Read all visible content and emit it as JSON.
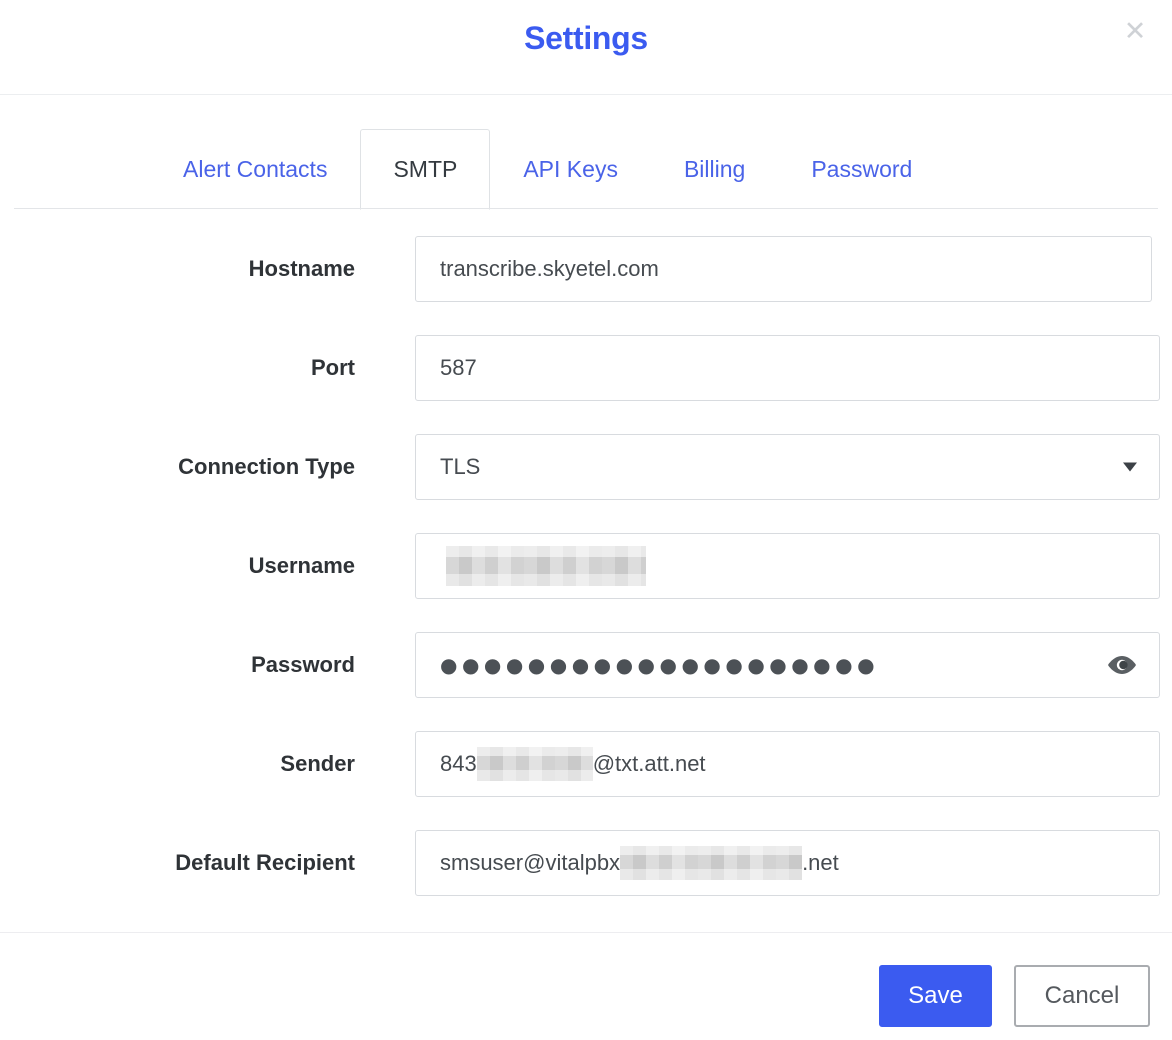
{
  "header": {
    "title": "Settings",
    "close_icon": "close-icon",
    "close_glyph": "✕"
  },
  "tabs": [
    {
      "label": "Alert Contacts",
      "active": false
    },
    {
      "label": "SMTP",
      "active": true
    },
    {
      "label": "API Keys",
      "active": false
    },
    {
      "label": "Billing",
      "active": false
    },
    {
      "label": "Password",
      "active": false
    }
  ],
  "form": {
    "hostname": {
      "label": "Hostname",
      "value": "transcribe.skyetel.com"
    },
    "port": {
      "label": "Port",
      "value": "587"
    },
    "connection_type": {
      "label": "Connection Type",
      "value": "TLS",
      "icon": "chevron-down-icon"
    },
    "username": {
      "label": "Username",
      "value": "",
      "redacted": true
    },
    "password": {
      "label": "Password",
      "value": "●●●●●●●●●●●●●●●●●●●●",
      "reveal_icon": "eye-icon"
    },
    "sender": {
      "label": "Sender",
      "value_prefix": "843",
      "value_suffix": "@txt.att.net",
      "redacted": true
    },
    "default_recipient": {
      "label": "Default Recipient",
      "value_prefix": "smsuser@vitalpbx",
      "value_suffix": ".net",
      "redacted": true
    }
  },
  "footer": {
    "save_label": "Save",
    "cancel_label": "Cancel"
  },
  "colors": {
    "accent": "#3b5bf0",
    "tab_link": "#4a63e8",
    "label_text": "#2f3337",
    "field_border": "#d8dbdf",
    "cancel_border": "#a9acb0"
  }
}
